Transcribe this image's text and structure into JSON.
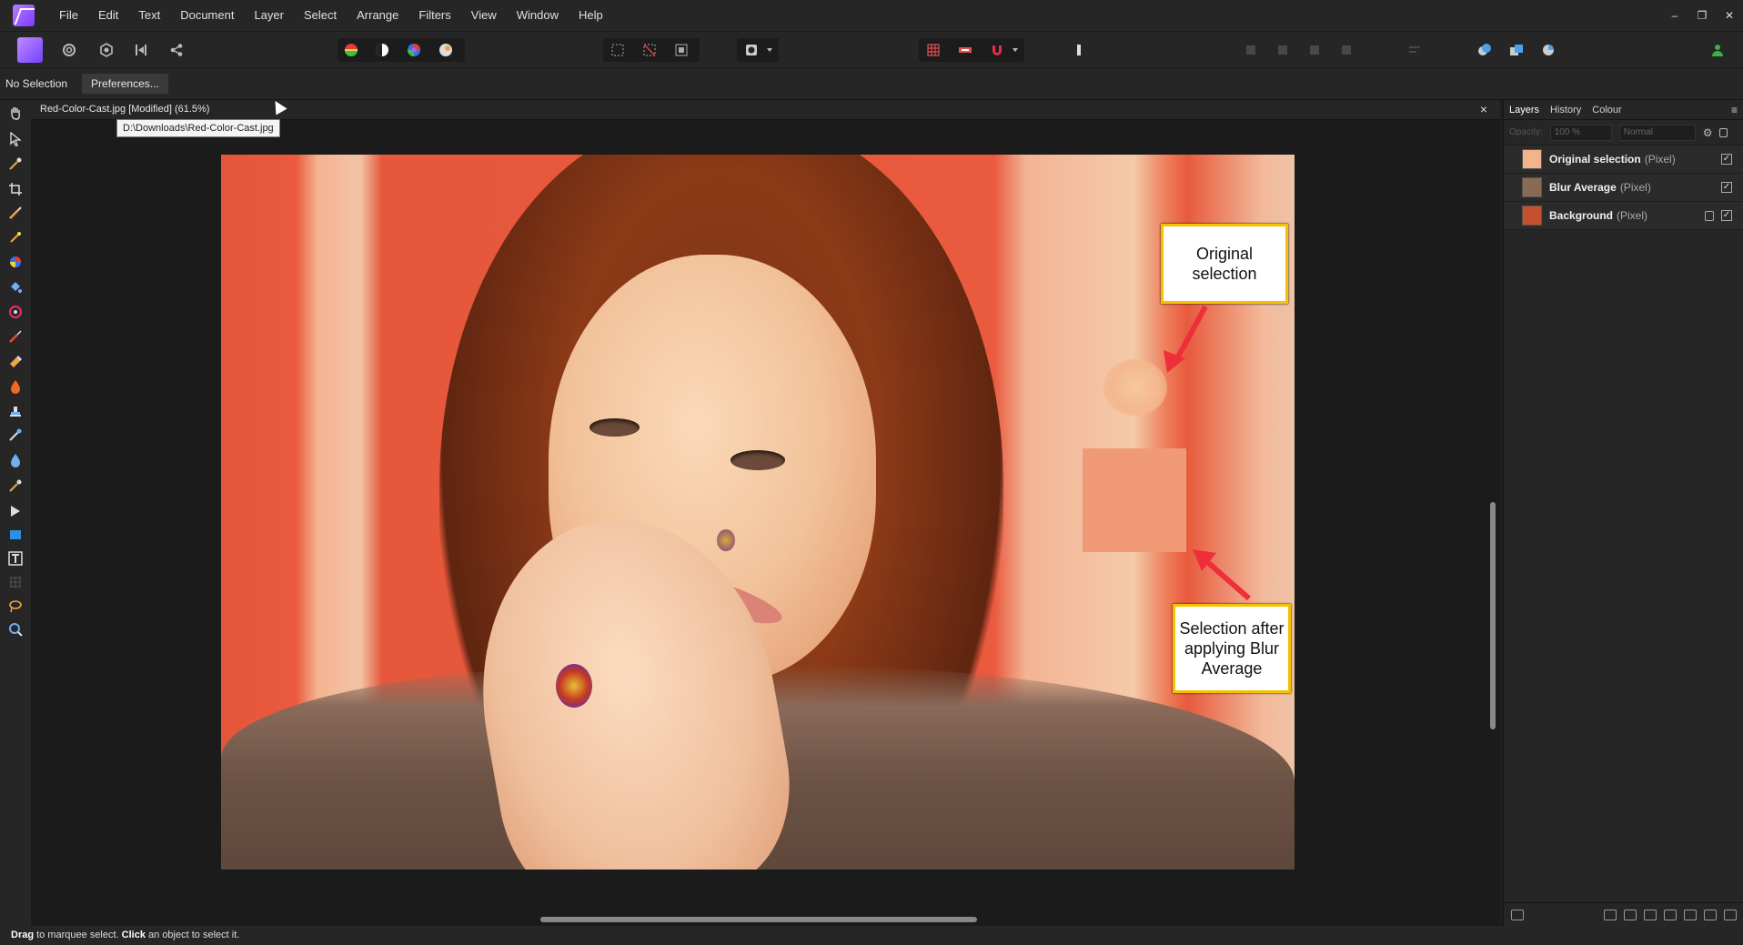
{
  "menu": [
    "File",
    "Edit",
    "Text",
    "Document",
    "Layer",
    "Select",
    "Arrange",
    "Filters",
    "View",
    "Window",
    "Help"
  ],
  "window_controls": [
    "–",
    "❐",
    "✕"
  ],
  "context": {
    "selection_status": "No Selection",
    "preferences_label": "Preferences..."
  },
  "document": {
    "tab_title": "Red-Color-Cast.jpg [Modified] (61.5%)",
    "tooltip": "D:\\Downloads\\Red-Color-Cast.jpg",
    "close": "×"
  },
  "callouts": {
    "original": "Original selection",
    "after": "Selection after applying Blur Average"
  },
  "panel": {
    "tabs": [
      "Layers",
      "History",
      "Colour"
    ],
    "opacity_label": "Opacity:",
    "opacity_value": "100 %",
    "blend_mode": "Normal",
    "layers": [
      {
        "name": "Original selection",
        "type": "(Pixel)",
        "thumb_color": "#f2b48c",
        "locked": false,
        "visible": true
      },
      {
        "name": "Blur Average",
        "type": "(Pixel)",
        "thumb_color": "#8b6a55",
        "locked": false,
        "visible": true
      },
      {
        "name": "Background",
        "type": "(Pixel)",
        "thumb_color": "#c4502f",
        "locked": true,
        "visible": true
      }
    ]
  },
  "status": {
    "bold1": "Drag",
    "text1": " to marquee select. ",
    "bold2": "Click",
    "text2": " an object to select it."
  },
  "colors": {
    "accent": "#8a4dff",
    "callout_border": "#f7c000",
    "arrow": "#ee2f3a"
  },
  "icons": [
    "photo-persona-icon",
    "liquify-persona-icon",
    "develop-persona-icon",
    "tone-mapping-persona-icon",
    "export-persona-icon",
    "hand-tool-icon",
    "move-tool-icon",
    "crop-tool-icon",
    "brush-tool-icon",
    "zoom-tool-icon"
  ]
}
